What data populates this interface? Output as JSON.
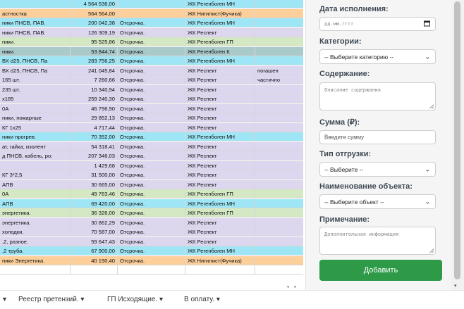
{
  "sheet": {
    "rows": [
      {
        "c1": "",
        "c2": "4 564 536,00",
        "c3": "",
        "c4": "ЖК Регенбоген МН",
        "c5": "",
        "bg": "blue"
      },
      {
        "c1": "астностка",
        "c2": "564 564,00",
        "c3": "",
        "c4": "ЖК Нигилист(Фучика)",
        "c5": "",
        "bg": "orange"
      },
      {
        "c1": "ники ПНСВ, ПАВ.",
        "c2": "200 042,38",
        "c3": "Отсрочка.",
        "c4": "ЖК Регенбоген МН",
        "c5": "",
        "bg": "blue"
      },
      {
        "c1": "ники ПНСВ, ПАВ.",
        "c2": "126 309,19",
        "c3": "Отсрочка.",
        "c4": "ЖК Респект",
        "c5": "",
        "bg": "purple"
      },
      {
        "c1": "ники.",
        "c2": "95 525,86",
        "c3": "Отсрочка.",
        "c4": "ЖК Регенбоген ГП",
        "c5": "",
        "bg": "green"
      },
      {
        "c1": "ники.",
        "c2": "53 844,74",
        "c3": "Отсрочка.",
        "c4": "ЖК Регенбоген К",
        "c5": "",
        "bg": "teal"
      },
      {
        "c1": "ВХ d25, ПНСВ, Па",
        "c2": "283 756,25",
        "c3": "Отсрочка.",
        "c4": "ЖК Регенбоген МН",
        "c5": "",
        "bg": "blue"
      },
      {
        "c1": "ВХ d25, ПНСВ, Па",
        "c2": "241 045,84",
        "c3": "Отсрочка.",
        "c4": "ЖК Респект",
        "c5": "погашен",
        "bg": "purple"
      },
      {
        "c1": " 165 шт.",
        "c2": "7 260,66",
        "c3": "Отсрочка.",
        "c4": "ЖК Респект",
        "c5": "частично",
        "bg": "purple"
      },
      {
        "c1": " 235 шт.",
        "c2": "10 340,94",
        "c3": "Отсрочка.",
        "c4": "ЖК Респект",
        "c5": "",
        "bg": "purple"
      },
      {
        "c1": "x185",
        "c2": "259 240,30",
        "c3": "Отсрочка.",
        "c4": "ЖК Респект",
        "c5": "",
        "bg": "purple"
      },
      {
        "c1": "0А",
        "c2": "46 796,90",
        "c3": "Отсрочка.",
        "c4": "ЖК Респект",
        "c5": "",
        "bg": "purple"
      },
      {
        "c1": "ники, пожарные",
        "c2": "29 852,13",
        "c3": "Отсрочка.",
        "c4": "ЖК Респект",
        "c5": "",
        "bg": "purple"
      },
      {
        "c1": " КГ 1x25",
        "c2": "4 717,44",
        "c3": "Отсрочка.",
        "c4": "ЖК Респект",
        "c5": "",
        "bg": "purple"
      },
      {
        "c1": "ники прогрев.",
        "c2": "70 352,00",
        "c3": "Отсрочка.",
        "c4": "ЖК Регенбоген МН",
        "c5": "",
        "bg": "blue"
      },
      {
        "c1": "ат, гайка, изолент",
        "c2": "54 318,41",
        "c3": "Отсрочка.",
        "c4": "ЖК Респект",
        "c5": "",
        "bg": "purple"
      },
      {
        "c1": "д ПНСВ, кабель, ро:",
        "c2": "207 346,03",
        "c3": "Отсрочка.",
        "c4": "ЖК Респект",
        "c5": "",
        "bg": "purple"
      },
      {
        "c1": "",
        "c2": "1 429,68",
        "c3": "Отсрочка.",
        "c4": "ЖК Респект",
        "c5": "",
        "bg": "purple"
      },
      {
        "c1": " КГ 3*2,5",
        "c2": "31 500,00",
        "c3": "Отсрочка.",
        "c4": "ЖК Респект",
        "c5": "",
        "bg": "purple"
      },
      {
        "c1": "АПВ",
        "c2": "30 665,00",
        "c3": "Отсрочка.",
        "c4": "ЖК Респект",
        "c5": "",
        "bg": "purple"
      },
      {
        "c1": "0А",
        "c2": "49 763,46",
        "c3": "Отсрочка.",
        "c4": "ЖК Регенбоген ГП",
        "c5": "",
        "bg": "green"
      },
      {
        "c1": "АПВ",
        "c2": "69 420,00",
        "c3": "Отсрочка.",
        "c4": "ЖК Регенбоген МН",
        "c5": "",
        "bg": "blue"
      },
      {
        "c1": " энергетика.",
        "c2": "36 326,00",
        "c3": "Отсрочка.",
        "c4": "ЖК Регенбоген ГП",
        "c5": "",
        "bg": "green"
      },
      {
        "c1": " энергетика.",
        "c2": "30 862,29",
        "c3": "Отсрочка.",
        "c4": "ЖК Респект",
        "c5": "",
        "bg": "purple"
      },
      {
        "c1": "холодки.",
        "c2": "70 587,00",
        "c3": "Отсрочка.",
        "c4": "ЖК Респект",
        "c5": "",
        "bg": "purple"
      },
      {
        "c1": ",2, разное.",
        "c2": "59 647,43",
        "c3": "Отсрочка.",
        "c4": "ЖК Респект",
        "c5": "",
        "bg": "purple"
      },
      {
        "c1": ",2 труба.",
        "c2": "67 900,00",
        "c3": "Отсрочка.",
        "c4": "ЖК Регенбоген МН",
        "c5": "",
        "bg": "blue"
      },
      {
        "c1": "ники Энергетика.",
        "c2": "40 190,40",
        "c3": "Отсрочка.",
        "c4": "ЖК Нигилист(Фучика)",
        "c5": "",
        "bg": "orange"
      },
      {
        "c1": "",
        "c2": "",
        "c3": "",
        "c4": "",
        "c5": "",
        "bg": "white"
      }
    ]
  },
  "form": {
    "date_label": "Дата исполнения:",
    "date_placeholder": "дд.мм.гггг",
    "category_label": "Категории:",
    "category_value": "-- Выберите категорию --",
    "content_label": "Содержание:",
    "content_placeholder": "Описание содержания",
    "sum_label": "Сумма (₽):",
    "sum_placeholder": "Введите сумму",
    "shipment_label": "Тип отгрузки:",
    "shipment_value": "-- Выберите --",
    "object_label": "Наименование объекта:",
    "object_value": "-- Выберите объект --",
    "note_label": "Примечание:",
    "note_placeholder": "Дополнительная информация",
    "add_button": "Добавить"
  },
  "tabs": [
    {
      "label": "Реестр претензий."
    },
    {
      "label": "ГП Исходящие."
    },
    {
      "label": "В оплату."
    }
  ],
  "colors": {
    "blue": "#9ee6f5",
    "orange": "#fccf9b",
    "purple": "#ddd6ef",
    "green": "#d5e8c4",
    "teal": "#aac9c9",
    "add_button": "#2e9a48"
  },
  "icons": {
    "calendar": "calendar-icon",
    "chevron": "chevron-down-icon",
    "tab_menu": "caret-down-icon"
  }
}
